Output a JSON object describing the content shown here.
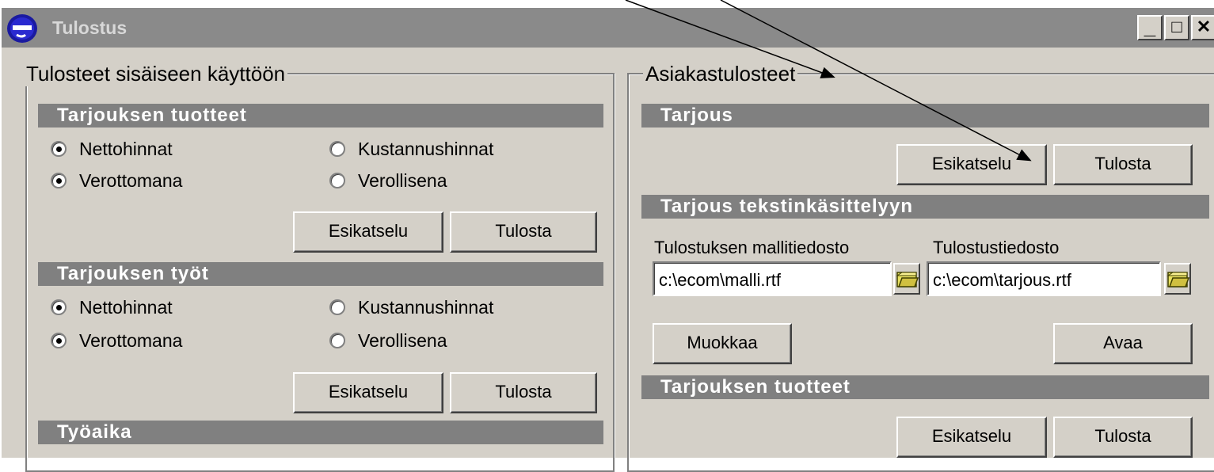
{
  "window": {
    "title": "Tulostus",
    "minimize": "_",
    "maximize": "□",
    "close": "✕"
  },
  "left_group": {
    "legend": "Tulosteet sisäiseen käyttöön",
    "sections": [
      {
        "title": "Tarjouksen tuotteet",
        "radios": [
          "Nettohinnat",
          "Kustannushinnat",
          "Verottomana",
          "Verollisena"
        ],
        "preview": "Esikatselu",
        "print": "Tulosta"
      },
      {
        "title": "Tarjouksen työt",
        "radios": [
          "Nettohinnat",
          "Kustannushinnat",
          "Verottomana",
          "Verollisena"
        ],
        "preview": "Esikatselu",
        "print": "Tulosta"
      },
      {
        "title": "Työaika"
      }
    ]
  },
  "right_group": {
    "legend": "Asiakastulosteet",
    "tarjous": {
      "title": "Tarjous",
      "preview": "Esikatselu",
      "print": "Tulosta"
    },
    "word": {
      "title": "Tarjous tekstinkäsittelyyn",
      "template_label": "Tulostuksen mallitiedosto",
      "template_value": "c:\\ecom\\malli.rtf",
      "output_label": "Tulostustiedosto",
      "output_value": "c:\\ecom\\tarjous.rtf",
      "edit": "Muokkaa",
      "open": "Avaa"
    },
    "products": {
      "title": "Tarjouksen tuotteet",
      "preview": "Esikatselu",
      "print": "Tulosta"
    }
  },
  "icons": {
    "app": "ecom-e-logo-icon",
    "browse": "folder-icon"
  },
  "colors": {
    "titlebar": "#8a8a8a",
    "section_bar": "#808080",
    "window_bg": "#d4d0c8",
    "logo": "#1a1aa0"
  }
}
